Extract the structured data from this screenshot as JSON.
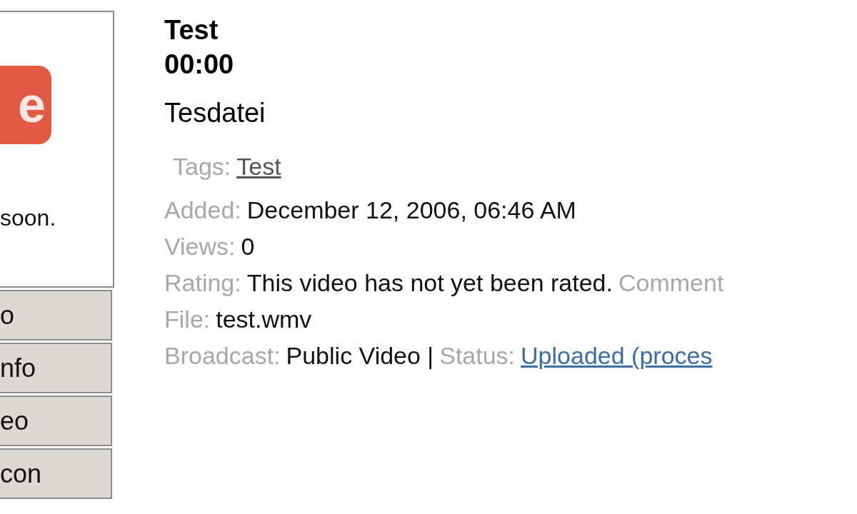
{
  "thumbnail": {
    "logo_text": "e",
    "caption": "soon."
  },
  "menu": [
    {
      "label": "o"
    },
    {
      "label": "nfo"
    },
    {
      "label": "eo"
    },
    {
      "label": "con"
    }
  ],
  "video": {
    "title": "Test",
    "duration": "00:00",
    "description": "Tesdatei",
    "tags": {
      "label": "Tags:",
      "link": "Test"
    },
    "added": {
      "label": "Added:",
      "value": "December 12, 2006, 06:46 AM"
    },
    "views": {
      "label": "Views:",
      "value": "0"
    },
    "rating": {
      "label": "Rating:",
      "value": "This video has not yet been rated.",
      "comments_label": "Comment"
    },
    "file": {
      "label": "File:",
      "value": "test.wmv"
    },
    "broadcast": {
      "label": "Broadcast:",
      "value": "Public Video |",
      "status_label": "Status:",
      "status_link": "Uploaded (proces"
    }
  }
}
